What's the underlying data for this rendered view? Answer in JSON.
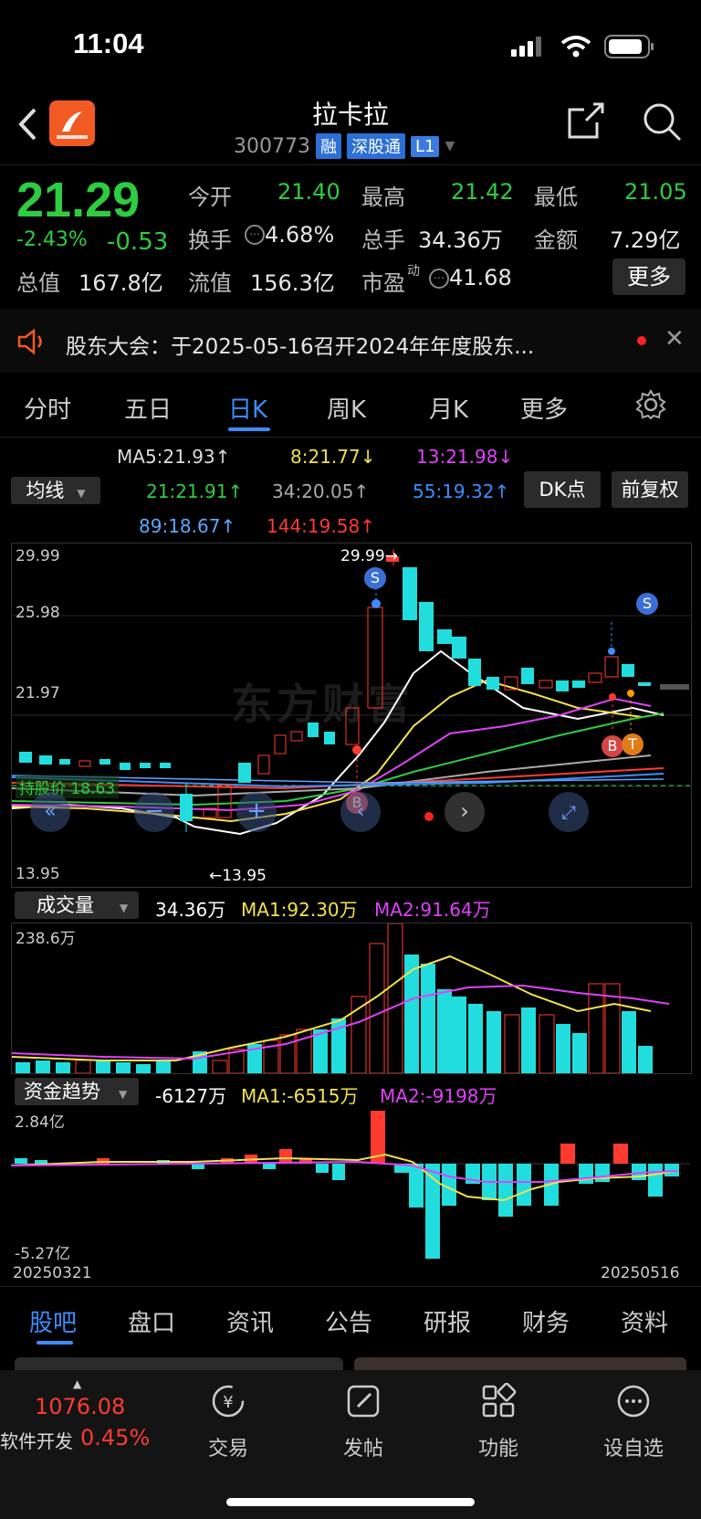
{
  "status": {
    "time": "11:04"
  },
  "header": {
    "name": "拉卡拉",
    "code": "300773",
    "tags": [
      "融",
      "深股通",
      "L1"
    ]
  },
  "quote": {
    "price": "21.29",
    "change_pct": "-2.43%",
    "change": "-0.53",
    "open_label": "今开",
    "open": "21.40",
    "high_label": "最高",
    "high": "21.42",
    "low_label": "最低",
    "low": "21.05",
    "turnover_label": "换手",
    "turnover": "4.68%",
    "volume_label": "总手",
    "volume": "34.36万",
    "amount_label": "金额",
    "amount": "7.29亿",
    "mcap_label": "总值",
    "mcap": "167.8亿",
    "float_label": "流值",
    "float": "156.3亿",
    "pe_label": "市盈",
    "pe_sup": "动",
    "pe": "41.68",
    "more": "更多"
  },
  "notice": {
    "text": "股东大会：于2025-05-16召开2024年年度股东..."
  },
  "tabs": [
    "分时",
    "五日",
    "日K",
    "周K",
    "月K",
    "更多"
  ],
  "active_tab": 2,
  "ma": {
    "selector": "均线",
    "ma5": "MA5:21.93↑",
    "ma8": "8:21.77↓",
    "ma13": "13:21.98↓",
    "ma21": "21:21.91↑",
    "ma34": "34:20.05↑",
    "ma55": "55:19.32↑",
    "ma89": "89:18.67↑",
    "ma144": "144:19.58↑",
    "dk": "DK点",
    "fq": "前复权"
  },
  "kline": {
    "y_labels": [
      "29.99",
      "25.98",
      "21.97",
      "13.95"
    ],
    "max_label": "29.99→",
    "min_label": "←13.95",
    "hold_label": "持股价 18.63",
    "watermark": "东方财富"
  },
  "volume": {
    "selector": "成交量",
    "value": "34.36万",
    "ma1": "MA1:92.30万",
    "ma2": "MA2:91.64万",
    "max": "238.6万"
  },
  "capital": {
    "selector": "资金趋势",
    "value": "-6127万",
    "ma1": "MA1:-6515万",
    "ma2": "MA2:-9198万",
    "max": "2.84亿",
    "min": "-5.27亿"
  },
  "dates": {
    "start": "20250321",
    "end": "20250516"
  },
  "bottom_tabs": [
    "股吧",
    "盘口",
    "资讯",
    "公告",
    "研报",
    "财务",
    "资料"
  ],
  "index": {
    "value": "1076.08",
    "name": "软件开发",
    "pct": "0.45%"
  },
  "nav": [
    "交易",
    "发帖",
    "功能",
    "设自选"
  ],
  "colors": {
    "up": "#ff3b30",
    "down": "#2ecc40",
    "accent": "#3b8dff",
    "cyan": "#22dddd"
  }
}
